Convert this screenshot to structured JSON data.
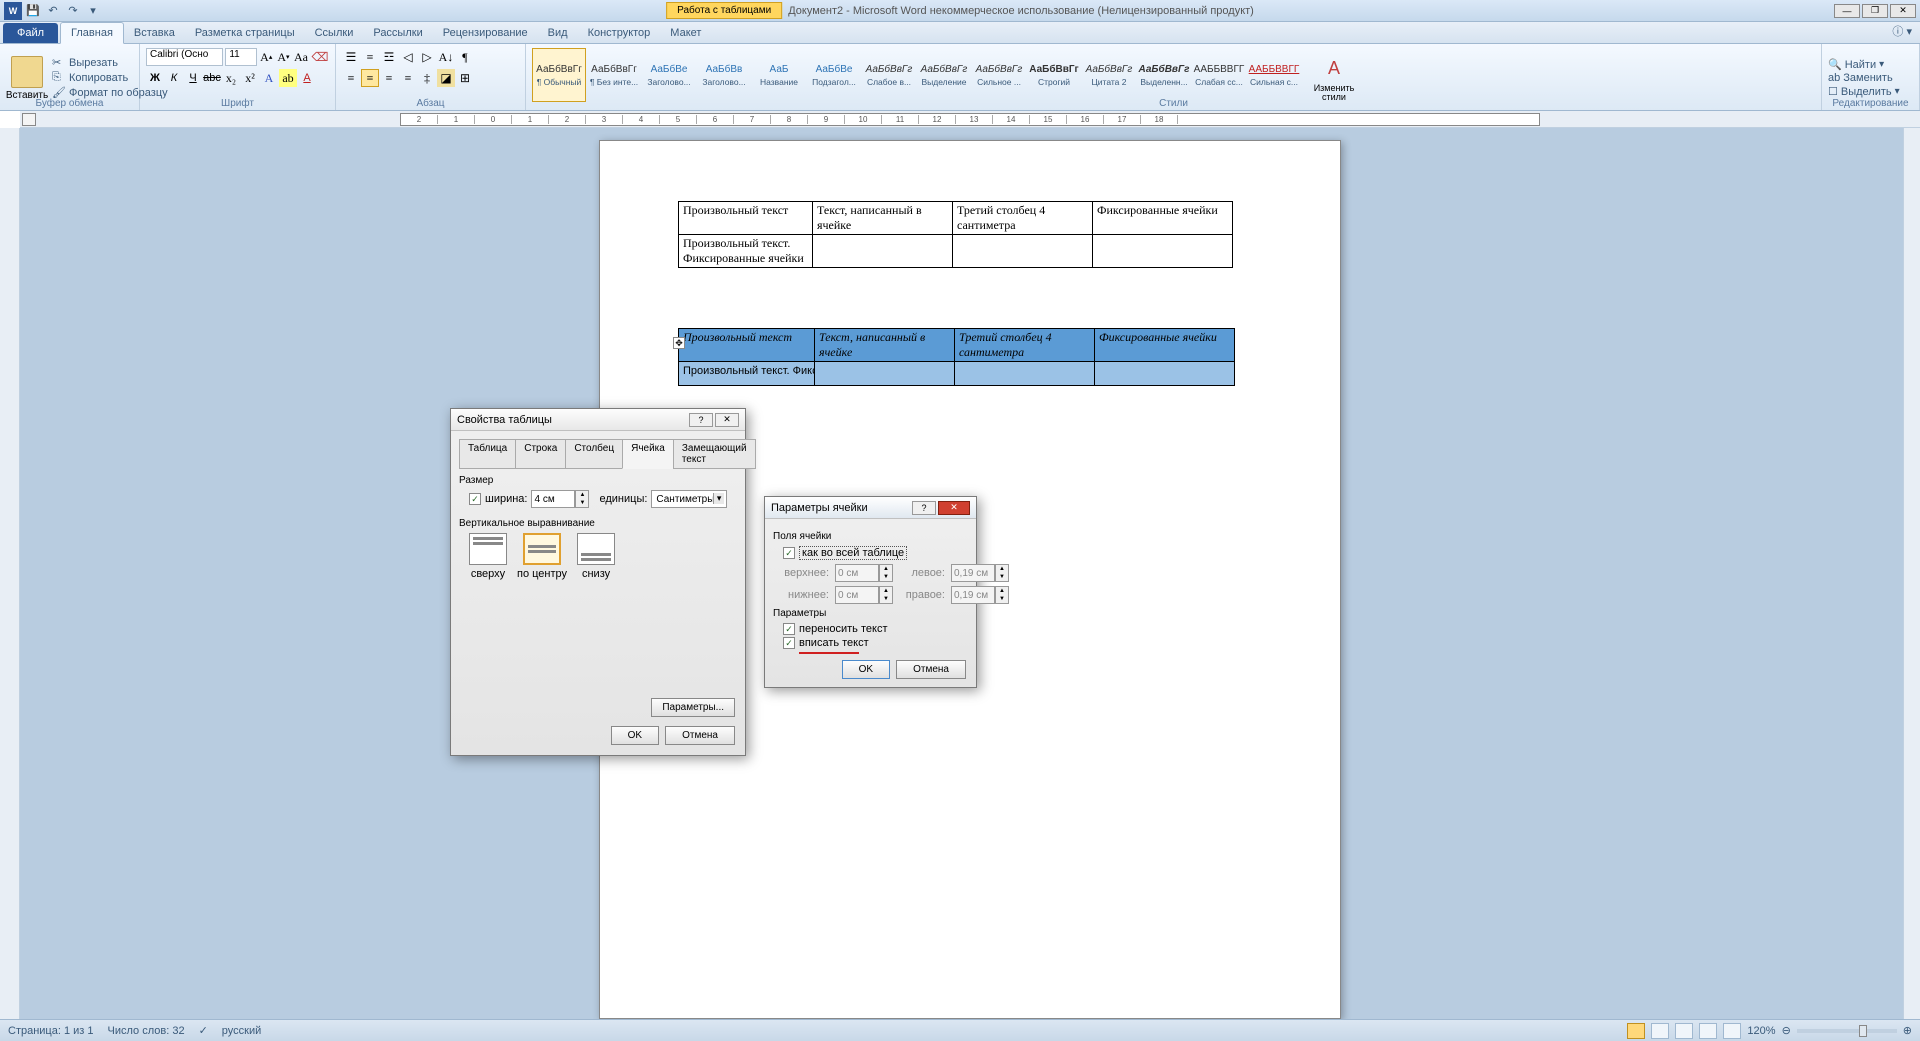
{
  "app": {
    "context_tab": "Работа с таблицами",
    "title": "Документ2 - Microsoft Word некоммерческое использование (Нелицензированный продукт)"
  },
  "tabs": {
    "file": "Файл",
    "home": "Главная",
    "insert": "Вставка",
    "layout": "Разметка страницы",
    "refs": "Ссылки",
    "mail": "Рассылки",
    "review": "Рецензирование",
    "view": "Вид",
    "design": "Конструктор",
    "tlayout": "Макет"
  },
  "ribbon": {
    "clipboard": {
      "paste": "Вставить",
      "cut": "Вырезать",
      "copy": "Копировать",
      "format": "Формат по образцу",
      "label": "Буфер обмена"
    },
    "font": {
      "name": "Calibri (Осно",
      "size": "11",
      "label": "Шрифт"
    },
    "para": {
      "label": "Абзац"
    },
    "styles": {
      "label": "Стили",
      "items": [
        {
          "prev": "АаБбВвГг",
          "name": "¶ Обычный",
          "cls": ""
        },
        {
          "prev": "АаБбВвГг",
          "name": "¶ Без инте...",
          "cls": ""
        },
        {
          "prev": "АаБбВе",
          "name": "Заголово...",
          "cls": "c1"
        },
        {
          "prev": "АаБбВв",
          "name": "Заголово...",
          "cls": "c1"
        },
        {
          "prev": "АаБ",
          "name": "Название",
          "cls": "c1"
        },
        {
          "prev": "АаБбВе",
          "name": "Подзагол...",
          "cls": "c1"
        },
        {
          "prev": "АаБбВвГг",
          "name": "Слабое в...",
          "cls": "i"
        },
        {
          "prev": "АаБбВвГг",
          "name": "Выделение",
          "cls": "i"
        },
        {
          "prev": "АаБбВвГг",
          "name": "Сильное ...",
          "cls": "i"
        },
        {
          "prev": "АаБбВвГг",
          "name": "Строгий",
          "cls": "b"
        },
        {
          "prev": "АаБбВвГг",
          "name": "Цитата 2",
          "cls": "i"
        },
        {
          "prev": "АаБбВвГг",
          "name": "Выделенн...",
          "cls": "bi"
        },
        {
          "prev": "ААББВВГГ",
          "name": "Слабая сс...",
          "cls": ""
        },
        {
          "prev": "ААББВВГГ",
          "name": "Сильная с...",
          "cls": "u"
        }
      ],
      "change": "Изменить стили"
    },
    "edit": {
      "find": "Найти",
      "replace": "Заменить",
      "select": "Выделить",
      "label": "Редактирование"
    }
  },
  "doc": {
    "table1": {
      "r1c1": "Произвольный текст",
      "r1c2": "Текст,  написанный  в ячейке",
      "r1c3": "Третий  столбец  4 сантиметра",
      "r1c4": "Фиксированные ячейки",
      "r2c1": "Произвольный текст. Фиксированные ячейки"
    },
    "table2": {
      "r1c1": "Произвольный текст",
      "r1c2": "Текст, написанный в ячейке",
      "r1c3": "Третий столбец 4 сантиметра",
      "r1c4": "Фиксированные ячейки",
      "r2c1": "Произвольный текст. Фиксированные ячейки"
    }
  },
  "dlg1": {
    "title": "Свойства таблицы",
    "tabs": {
      "table": "Таблица",
      "row": "Строка",
      "col": "Столбец",
      "cell": "Ячейка",
      "alt": "Замещающий текст"
    },
    "size": "Размер",
    "width_lbl": "ширина:",
    "width_val": "4 см",
    "units_lbl": "единицы:",
    "units_val": "Сантиметры",
    "valign": "Вертикальное выравнивание",
    "top": "сверху",
    "center": "по центру",
    "bottom": "снизу",
    "params": "Параметры...",
    "ok": "OK",
    "cancel": "Отмена"
  },
  "dlg2": {
    "title": "Параметры ячейки",
    "margins": "Поля ячейки",
    "as_table": "как во всей таблице",
    "top": "верхнее:",
    "bottom": "нижнее:",
    "left": "левое:",
    "right": "правое:",
    "v0": "0 см",
    "v019": "0,19 см",
    "options": "Параметры",
    "wrap": "переносить текст",
    "fit": "вписать текст",
    "ok": "OK",
    "cancel": "Отмена"
  },
  "status": {
    "page": "Страница: 1 из 1",
    "words": "Число слов: 32",
    "lang": "русский",
    "zoom": "120%"
  }
}
